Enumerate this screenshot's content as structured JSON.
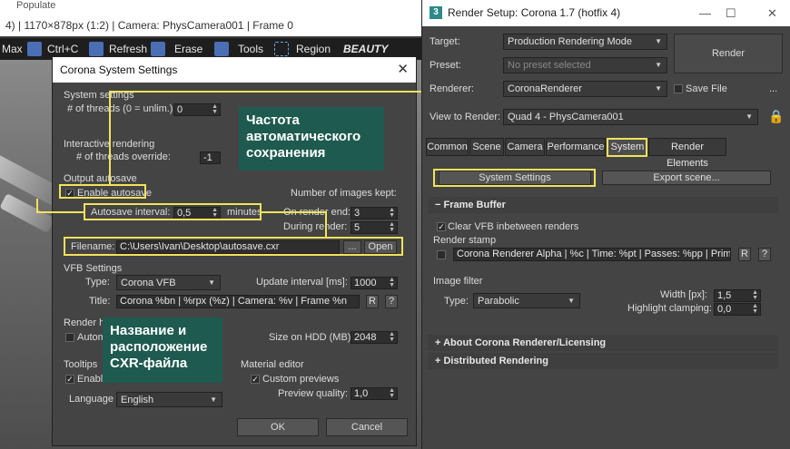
{
  "vfb": {
    "title_prefix": "4) | 1170×878px (1:2) | Camera: PhysCamera001 | Frame 0",
    "populate": "Populate",
    "toolbar": {
      "max": "Max",
      "ctrl_c": "Ctrl+C",
      "refresh": "Refresh",
      "erase": "Erase",
      "tools": "Tools",
      "region": "Region",
      "beauty": "BEAUTY"
    }
  },
  "system_settings": {
    "title": "Corona System Settings",
    "close": "✕",
    "system_section": "System settings",
    "threads_label": "# of threads (0 = unlim.):",
    "threads_value": "0",
    "interactive_section": "Interactive rendering",
    "threads_override_label": "# of threads override:",
    "threads_override_value": "-1",
    "output_section": "Output autosave",
    "enable_autosave": "Enable autosave",
    "autosave_interval_label": "Autosave interval:",
    "autosave_interval_value": "0,5",
    "minutes": "minutes",
    "images_kept_label": "Number of images kept:",
    "on_render_end_label": "On render end:",
    "on_render_end_value": "3",
    "during_render_label": "During render:",
    "during_render_value": "5",
    "filename_label": "Filename:",
    "filename_value": "C:\\Users\\Ivan\\Desktop\\autosave.cxr",
    "browse": "...",
    "open": "Open",
    "vfb_section": "VFB Settings",
    "type_label": "Type:",
    "type_value": "Corona VFB",
    "update_interval_label": "Update interval [ms]:",
    "update_interval_value": "1000",
    "title_label": "Title:",
    "title_value": "Corona %bn | %rpx (%z) | Camera: %v | Frame %n",
    "r_btn": "R",
    "q_btn": "?",
    "render_history_section": "Render hi",
    "autom": "Autom",
    "size_hdd_label": "Size on HDD (MB):",
    "size_hdd_value": "2048",
    "tooltips_section": "Tooltips",
    "enable_tt": "Enable",
    "language_label": "Language",
    "language_value": "English",
    "material_section": "Material editor",
    "custom_previews": "Custom previews",
    "preview_quality_label": "Preview quality:",
    "preview_quality_value": "1,0",
    "ok": "OK",
    "cancel": "Cancel"
  },
  "callouts": {
    "autosave_freq": "Частота\nавтоматического\nсохранения",
    "cxr_file": "Название и\nрасположение\nCXR-файла"
  },
  "render_setup": {
    "title": "Render Setup: Corona 1.7 (hotfix 4)",
    "logo": "3",
    "minimize": "—",
    "maximize": "☐",
    "close": "✕",
    "target_label": "Target:",
    "target_value": "Production Rendering Mode",
    "preset_label": "Preset:",
    "preset_value": "No preset selected",
    "renderer_label": "Renderer:",
    "renderer_value": "CoronaRenderer",
    "save_file": "Save File",
    "more": "...",
    "view_label": "View to Render:",
    "view_value": "Quad 4 - PhysCamera001",
    "render_btn": "Render",
    "tabs": [
      "Common",
      "Scene",
      "Camera",
      "Performance",
      "System",
      "Render Elements"
    ],
    "system_settings_btn": "System Settings",
    "export_scene_btn": "Export scene...",
    "frame_buffer": "Frame Buffer",
    "clear_vfb": "Clear VFB inbetween renders",
    "render_stamp": "Render stamp",
    "stamp_value": "Corona Renderer Alpha | %c | Time: %pt | Passes: %pp | Primitives",
    "r_btn": "R",
    "q_btn": "?",
    "image_filter": "Image filter",
    "type_label": "Type:",
    "type_value": "Parabolic",
    "width_label": "Width [px]:",
    "width_value": "1,5",
    "highlight_label": "Highlight clamping:",
    "highlight_value": "0,0",
    "about": "About Corona Renderer/Licensing",
    "distributed": "Distributed Rendering"
  },
  "colors": {
    "highlight": "#f2e25a",
    "callout_bg": "#1e5a4f"
  }
}
